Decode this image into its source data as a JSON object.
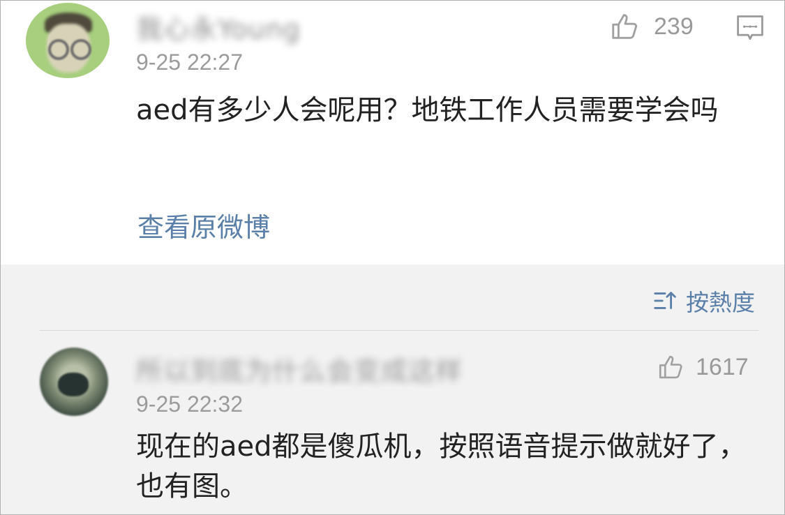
{
  "original_comment": {
    "username": "我心永Young",
    "timestamp": "9-25 22:27",
    "text": "aed有多少人会呢用？地铁工作人员需要学会吗",
    "like_count": "239",
    "view_original": "查看原微博"
  },
  "replies": {
    "sort_label": "按熱度",
    "items": [
      {
        "username": "所以到底为什么会变成这样",
        "timestamp": "9-25 22:32",
        "text": "现在的aed都是傻瓜机，按照语音提示做就好了，也有图。",
        "like_count": "1617"
      }
    ]
  },
  "icons": {
    "like": "thumbs-up-icon",
    "comment": "comment-icon",
    "sort": "sort-icon"
  },
  "colors": {
    "link": "#5a7fa8",
    "muted": "#9b9b9b",
    "background": "#ffffff",
    "section_bg": "#f2f2f2"
  }
}
